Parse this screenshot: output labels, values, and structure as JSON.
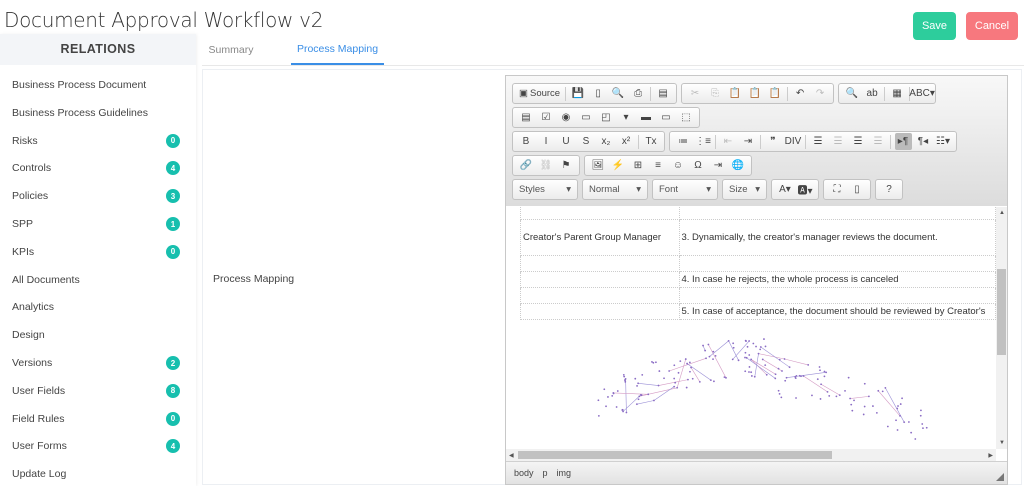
{
  "page": {
    "title": "Document Approval Workflow v2",
    "save_label": "Save",
    "cancel_label": "Cancel"
  },
  "sidebar": {
    "header": "RELATIONS",
    "items": [
      {
        "label": "Business Process Document",
        "badge": null
      },
      {
        "label": "Business Process Guidelines",
        "badge": null
      },
      {
        "label": "Risks",
        "badge": "0"
      },
      {
        "label": "Controls",
        "badge": "4"
      },
      {
        "label": "Policies",
        "badge": "3"
      },
      {
        "label": "SPP",
        "badge": "1"
      },
      {
        "label": "KPIs",
        "badge": "0"
      },
      {
        "label": "All Documents",
        "badge": null
      },
      {
        "label": "Analytics",
        "badge": null
      },
      {
        "label": "Design",
        "badge": null
      },
      {
        "label": "Versions",
        "badge": "2"
      },
      {
        "label": "User Fields",
        "badge": "8"
      },
      {
        "label": "Field Rules",
        "badge": "0"
      },
      {
        "label": "User Forms",
        "badge": "4"
      },
      {
        "label": "Update Log",
        "badge": null
      }
    ]
  },
  "tabs": [
    {
      "label": "Summary",
      "active": false
    },
    {
      "label": "Process Mapping",
      "active": true
    }
  ],
  "main": {
    "field_label": "Process Mapping"
  },
  "editor": {
    "source_label": "Source",
    "toolbar_rows": [
      [
        [
          {
            "name": "save-icon",
            "g": "💾"
          },
          {
            "name": "new-page-icon",
            "g": "▯"
          },
          {
            "name": "preview-icon",
            "g": "🔍"
          },
          {
            "name": "print-icon",
            "g": "⎙"
          },
          {
            "sep": true
          },
          {
            "name": "templates-icon",
            "g": "▤"
          }
        ],
        [
          {
            "name": "cut-icon",
            "g": "✂",
            "dis": true
          },
          {
            "name": "copy-icon",
            "g": "⎘",
            "dis": true
          },
          {
            "name": "paste-icon",
            "g": "📋"
          },
          {
            "name": "paste-text-icon",
            "g": "📋"
          },
          {
            "name": "paste-word-icon",
            "g": "📋"
          },
          {
            "sep": true
          },
          {
            "name": "undo-icon",
            "g": "↶"
          },
          {
            "name": "redo-icon",
            "g": "↷",
            "dis": true
          }
        ],
        [
          {
            "name": "find-icon",
            "g": "🔍"
          },
          {
            "name": "replace-icon",
            "g": "ab"
          },
          {
            "sep": true
          },
          {
            "name": "select-all-icon",
            "g": "▦"
          },
          {
            "sep": true
          },
          {
            "name": "spellcheck-icon",
            "g": "ABC▾"
          }
        ]
      ],
      [
        [
          {
            "name": "form-icon",
            "g": "▤"
          },
          {
            "name": "checkbox-icon",
            "g": "☑"
          },
          {
            "name": "radio-icon",
            "g": "◉"
          },
          {
            "name": "text-field-icon",
            "g": "▭"
          },
          {
            "name": "textarea-icon",
            "g": "◰"
          },
          {
            "name": "select-icon",
            "g": "▾"
          },
          {
            "name": "button-icon",
            "g": "▬"
          },
          {
            "name": "image-button-icon",
            "g": "▭"
          },
          {
            "name": "hidden-field-icon",
            "g": "⬚"
          }
        ]
      ],
      [
        [
          {
            "name": "bold-icon",
            "g": "B"
          },
          {
            "name": "italic-icon",
            "g": "I"
          },
          {
            "name": "underline-icon",
            "g": "U"
          },
          {
            "name": "strikethrough-icon",
            "g": "S"
          },
          {
            "name": "subscript-icon",
            "g": "x₂"
          },
          {
            "name": "superscript-icon",
            "g": "x²"
          },
          {
            "sep": true
          },
          {
            "name": "remove-format-icon",
            "g": "Tx"
          }
        ],
        [
          {
            "name": "numbered-list-icon",
            "g": "≔"
          },
          {
            "name": "bulleted-list-icon",
            "g": "⋮≡"
          },
          {
            "sep": true
          },
          {
            "name": "outdent-icon",
            "g": "⇤",
            "dis": true
          },
          {
            "name": "indent-icon",
            "g": "⇥"
          },
          {
            "sep": true
          },
          {
            "name": "blockquote-icon",
            "g": "❞"
          },
          {
            "name": "div-icon",
            "g": "DIV"
          },
          {
            "sep": true
          },
          {
            "name": "align-left-icon",
            "g": "☰"
          },
          {
            "name": "align-center-icon",
            "g": "☰",
            "dis": true
          },
          {
            "name": "align-right-icon",
            "g": "☰"
          },
          {
            "name": "justify-icon",
            "g": "☰",
            "dis": true
          },
          {
            "sep": true
          },
          {
            "name": "ltr-icon",
            "g": "▸¶",
            "on": true
          },
          {
            "name": "rtl-icon",
            "g": "¶◂"
          },
          {
            "name": "language-icon",
            "g": "☷▾"
          }
        ]
      ],
      [
        [
          {
            "name": "link-icon",
            "g": "🔗"
          },
          {
            "name": "unlink-icon",
            "g": "⛓",
            "dis": true
          },
          {
            "name": "anchor-icon",
            "g": "⚑"
          }
        ],
        [
          {
            "name": "image-icon",
            "g": "🖼"
          },
          {
            "name": "flash-icon",
            "g": "⚡"
          },
          {
            "name": "table-icon",
            "g": "⊞"
          },
          {
            "name": "horizontal-rule-icon",
            "g": "≡"
          },
          {
            "name": "smiley-icon",
            "g": "☺"
          },
          {
            "name": "special-char-icon",
            "g": "Ω"
          },
          {
            "name": "page-break-icon",
            "g": "⇥"
          },
          {
            "name": "iframe-icon",
            "g": "🌐"
          }
        ]
      ]
    ],
    "combos": [
      {
        "name": "styles-combo",
        "label": "Styles"
      },
      {
        "name": "format-combo",
        "label": "Normal"
      },
      {
        "name": "font-combo",
        "label": "Font"
      },
      {
        "name": "size-combo",
        "label": "Size"
      }
    ],
    "row5_groups": [
      [
        {
          "name": "text-color-icon",
          "g": "A▾"
        },
        {
          "name": "bg-color-icon",
          "g": "🅰▾"
        }
      ],
      [
        {
          "name": "maximize-icon",
          "g": "⛶"
        },
        {
          "name": "show-blocks-icon",
          "g": "▯"
        }
      ],
      [
        {
          "name": "help-icon",
          "g": "?"
        }
      ]
    ],
    "table_rows": [
      [
        "",
        ""
      ],
      [
        "Creator's Parent Group Manager",
        "3. Dynamically, the creator's manager reviews the document."
      ],
      [
        "",
        ""
      ],
      [
        "",
        "4. In case he rejects, the whole process is canceled"
      ],
      [
        "",
        ""
      ],
      [
        "",
        "5. In case of acceptance, the document should be reviewed by Creator's"
      ]
    ],
    "path": [
      "body",
      "p",
      "img"
    ]
  },
  "colors": {
    "accent": "#3a8ee6",
    "badge": "#17bfae",
    "save": "#2dcd9c",
    "cancel": "#f7787e"
  }
}
